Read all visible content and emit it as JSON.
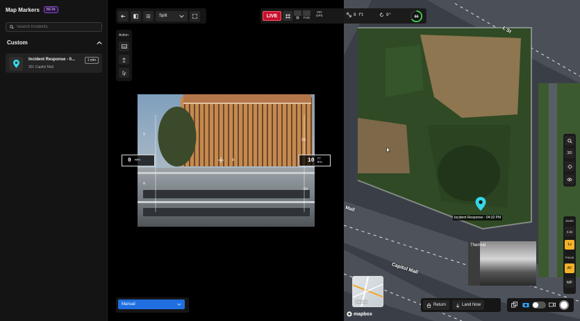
{
  "sidebar": {
    "title": "Map Markers",
    "beta": "BETA",
    "search_placeholder": "Search Incidents",
    "section": "Custom",
    "incident": {
      "title": "Incident Response - 0...",
      "address": "301 Capitol Mall",
      "badge": "1 min"
    }
  },
  "toolbar": {
    "view_mode": "Split"
  },
  "action_panel": {
    "label": "Action"
  },
  "hud": {
    "speed": "0",
    "speed_unit_1": "MPH",
    "altitude": "10",
    "alt_unit_1": "FT",
    "alt_unit_2": "RAL",
    "left_scale": [
      "5",
      "0"
    ],
    "right_scale": [
      "50",
      "-50"
    ],
    "center": "0"
  },
  "status": {
    "live": "LIVE",
    "fus": "FUS",
    "vio": "VIO",
    "gps": "GPS",
    "distance": "0 ft",
    "heading": "0°",
    "battery": "66"
  },
  "flight_mode": {
    "selected": "Manual"
  },
  "map": {
    "zoom_label": "Zoom",
    "zoom_level": "4.3x",
    "zoom_1x": "1x",
    "focus_label": "Focus",
    "af": "AF",
    "mf": "MF",
    "btn_3d": "3D",
    "pin_label": "Incident Response - 04:32 PM",
    "thermal": "Thermal",
    "minimap": "Streets",
    "attribution": "mapbox",
    "roads": [
      "L St",
      "Mall",
      "Capitol Mall"
    ],
    "return": "Return",
    "land": "Land Now"
  },
  "colors": {
    "live_red": "#c8102e",
    "marker_cyan": "#35d7e8",
    "battery_green": "#3fcf4e",
    "manual_blue": "#1f6fe0",
    "zoom_yellow": "#f3b228"
  }
}
